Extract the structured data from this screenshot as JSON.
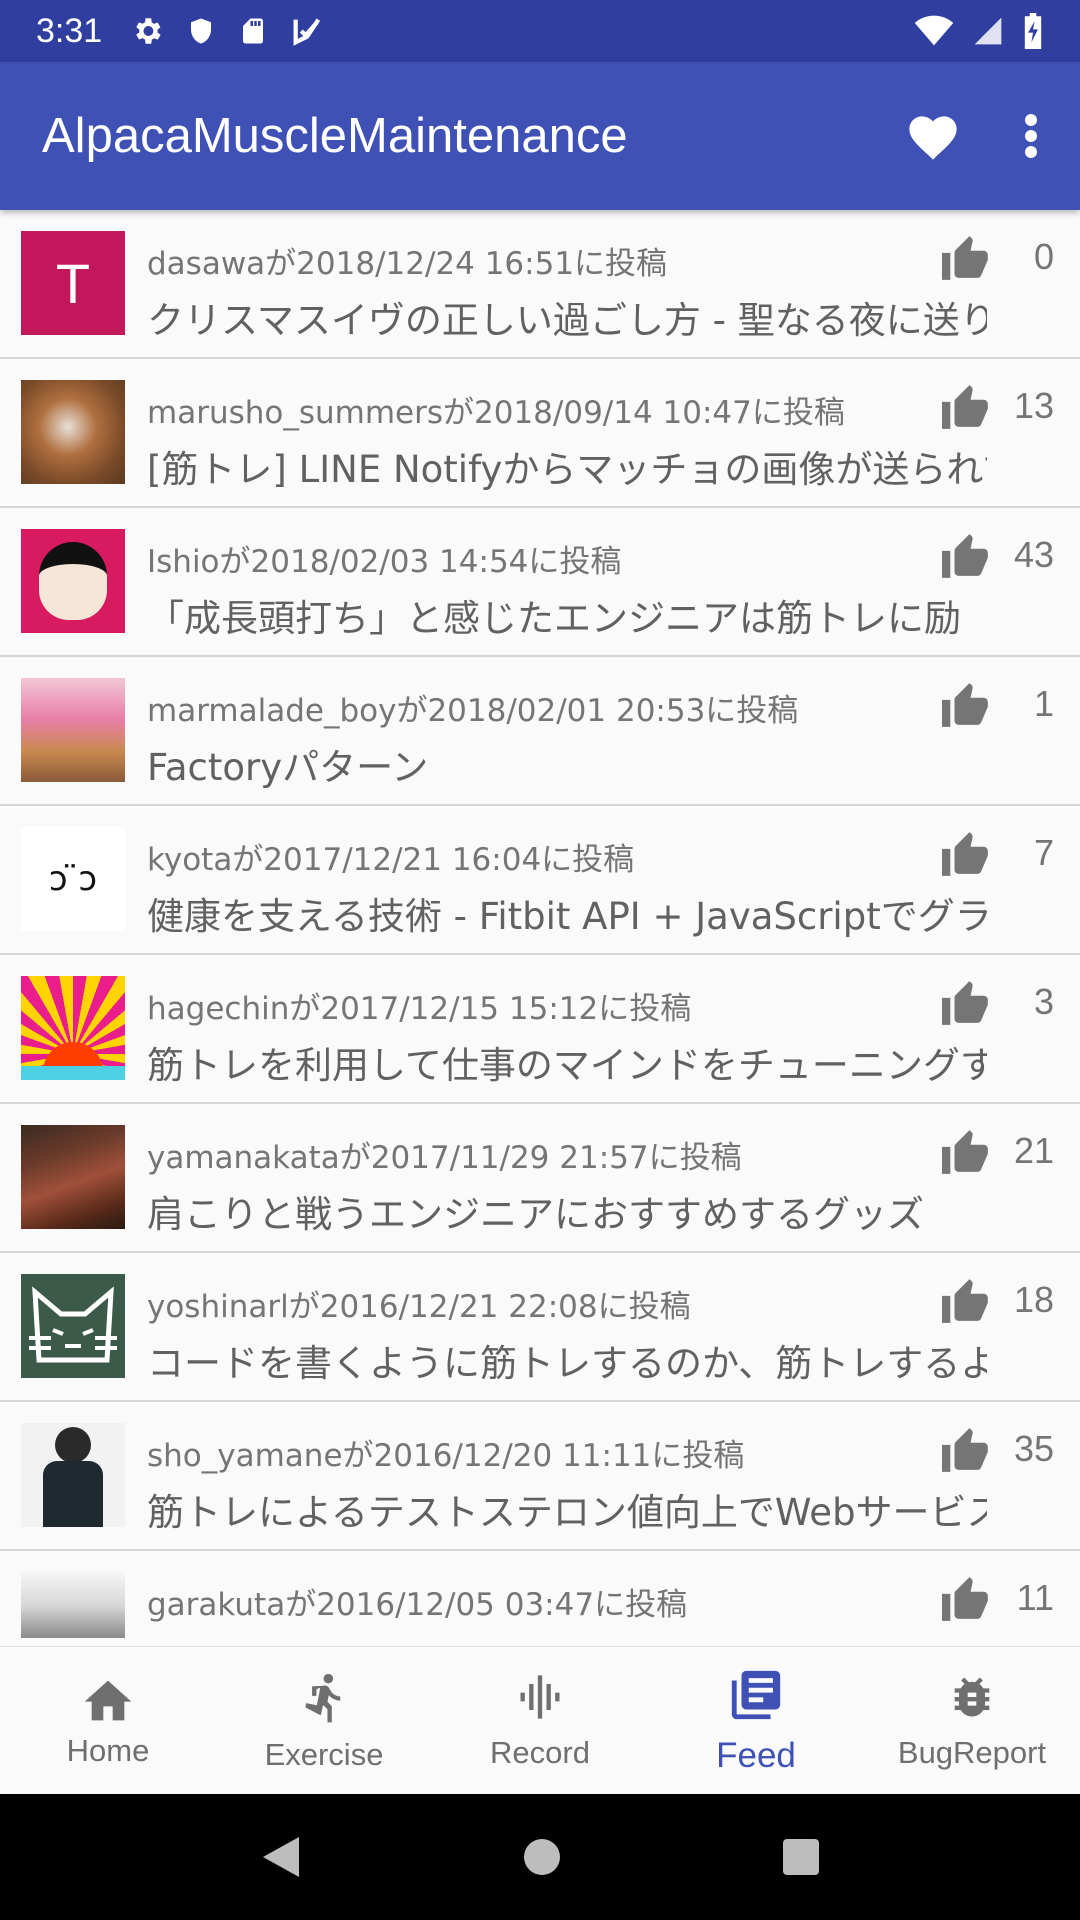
{
  "status_bar": {
    "time": "3:31"
  },
  "app_bar": {
    "title": "AlpacaMuscleMaintenance"
  },
  "feed": [
    {
      "meta": "dasawaが2018/12/24 16:51に投稿",
      "title": "クリスマスイヴの正しい過ごし方 - 聖なる夜に送り",
      "likes": "0",
      "avatar": "T"
    },
    {
      "meta": "marusho_summersが2018/09/14 10:47に投稿",
      "title": "[筋トレ] LINE Notifyからマッチョの画像が送られて",
      "likes": "13"
    },
    {
      "meta": "Ishioが2018/02/03 14:54に投稿",
      "title": "「成長頭打ち」と感じたエンジニアは筋トレに励",
      "likes": "43"
    },
    {
      "meta": "marmalade_boyが2018/02/01 20:53に投稿",
      "title": "Factoryパターン",
      "likes": "1"
    },
    {
      "meta": "kyotaが2017/12/21 16:04に投稿",
      "title": "健康を支える技術 - Fitbit API + JavaScriptでグラフ",
      "likes": "7",
      "avatar": "ↄ ̈ↄ"
    },
    {
      "meta": "hagechinが2017/12/15 15:12に投稿",
      "title": "筋トレを利用して仕事のマインドをチューニングす",
      "likes": "3"
    },
    {
      "meta": "yamanakataが2017/11/29 21:57に投稿",
      "title": "肩こりと戦うエンジニアにおすすめするグッズ",
      "likes": "21"
    },
    {
      "meta": "yoshinarlが2016/12/21 22:08に投稿",
      "title": "コードを書くように筋トレするのか、筋トレするよ",
      "likes": "18"
    },
    {
      "meta": "sho_yamaneが2016/12/20 11:11に投稿",
      "title": "筋トレによるテストステロン値向上でWebサービス",
      "likes": "35"
    },
    {
      "meta": "garakutaが2016/12/05 03:47に投稿",
      "title": "",
      "likes": "11"
    }
  ],
  "bottom_nav": [
    {
      "label": "Home",
      "icon": "home-icon"
    },
    {
      "label": "Exercise",
      "icon": "run-icon"
    },
    {
      "label": "Record",
      "icon": "waveform-icon"
    },
    {
      "label": "Feed",
      "icon": "feed-icon",
      "active": true
    },
    {
      "label": "BugReport",
      "icon": "bug-icon"
    }
  ],
  "colors": {
    "primary": "#3f51b5",
    "primary_dark": "#303f9f",
    "avatar_t": "#c2185b"
  }
}
